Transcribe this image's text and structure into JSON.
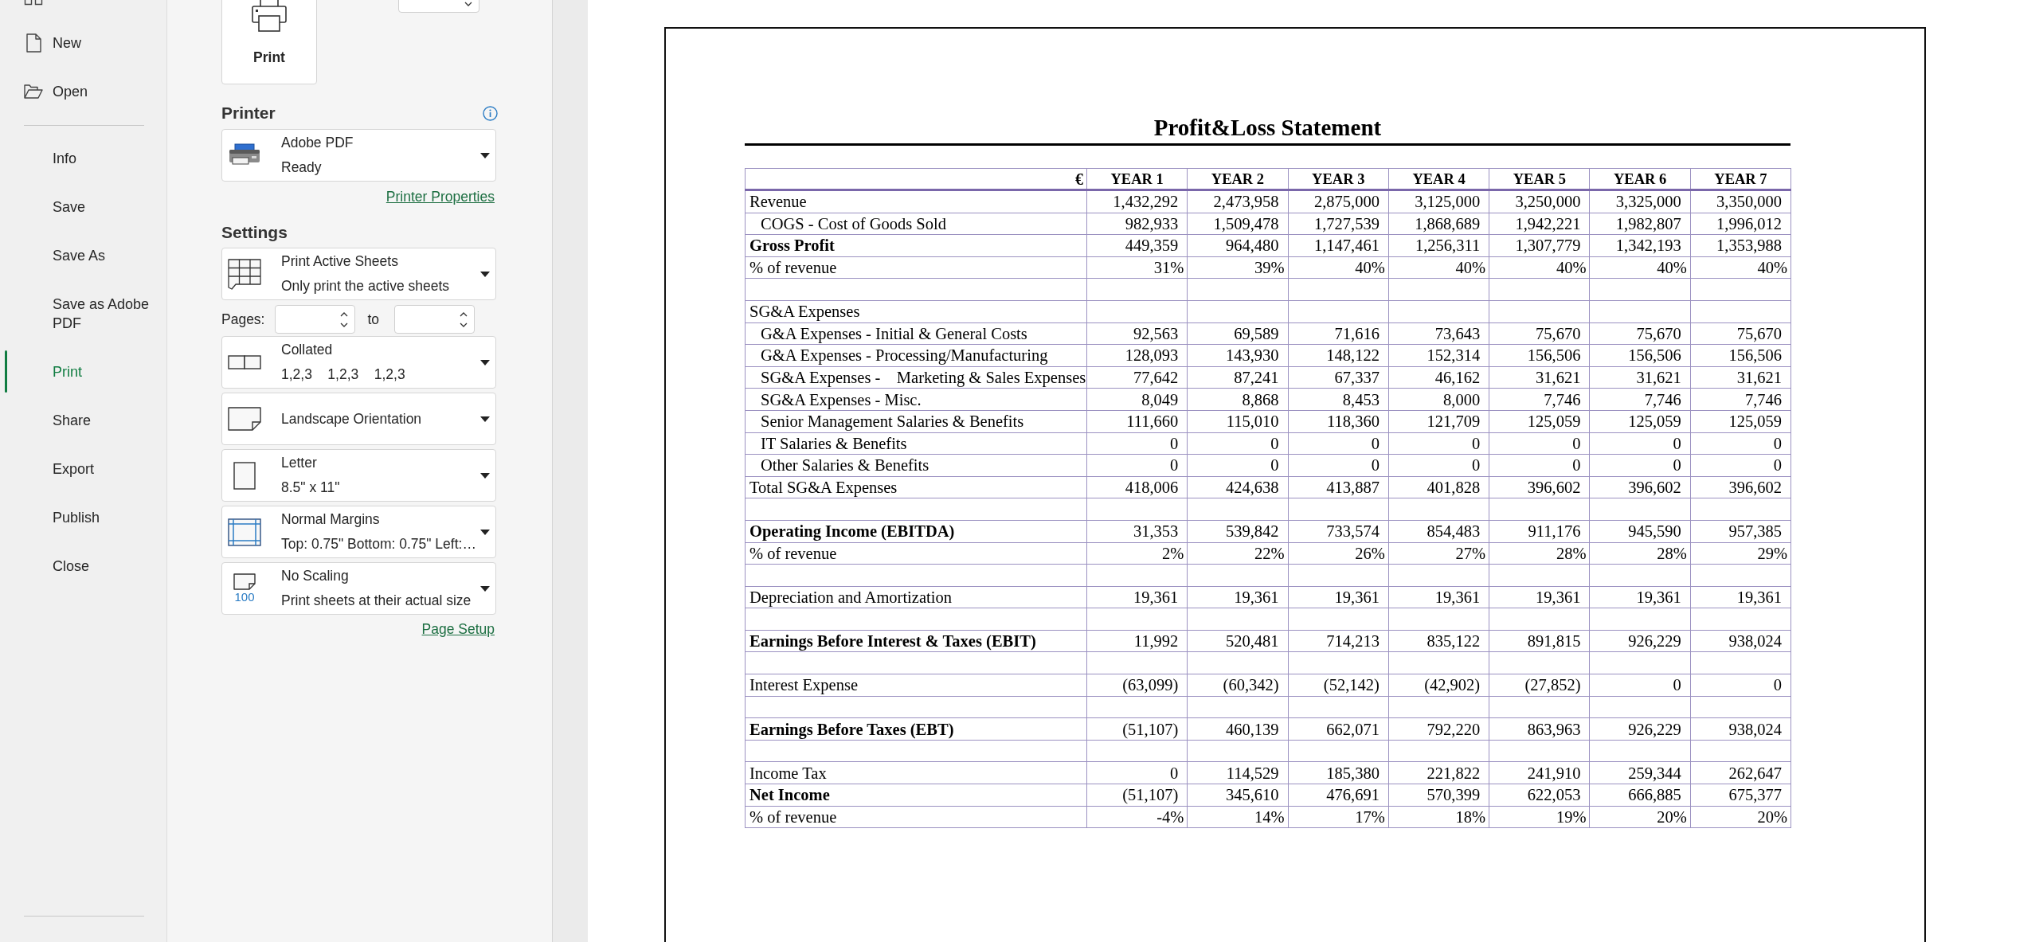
{
  "nav": {
    "top_items": [
      {
        "label": "New",
        "selected": false
      },
      {
        "label": "Open",
        "selected": false
      }
    ],
    "items": [
      {
        "label": "Info",
        "selected": false
      },
      {
        "label": "Save",
        "selected": false
      },
      {
        "label": "Save As",
        "selected": false
      },
      {
        "label": "Save as Adobe PDF",
        "selected": false
      },
      {
        "label": "Print",
        "selected": true
      },
      {
        "label": "Share",
        "selected": false
      },
      {
        "label": "Export",
        "selected": false
      },
      {
        "label": "Publish",
        "selected": false
      },
      {
        "label": "Close",
        "selected": false
      }
    ]
  },
  "print_panel": {
    "print_button": "Print"
  },
  "printer": {
    "heading": "Printer",
    "name": "Adobe PDF",
    "status": "Ready",
    "properties_link": "Printer Properties"
  },
  "settings": {
    "heading": "Settings",
    "items": [
      {
        "kind": "dropdown",
        "title": "Print Active Sheets",
        "subtitle": "Only print the active sheets"
      },
      {
        "kind": "pages",
        "label": "Pages:",
        "separator": "to"
      },
      {
        "kind": "dropdown",
        "title": "Collated",
        "subtitle": "1,2,3    1,2,3    1,2,3"
      },
      {
        "kind": "dropdown",
        "title": "Landscape Orientation"
      },
      {
        "kind": "dropdown",
        "title": "Letter",
        "subtitle": "8.5\" x 11\""
      },
      {
        "kind": "dropdown",
        "title": "Normal Margins",
        "subtitle": "Top: 0.75\" Bottom: 0.75\" Left:…"
      },
      {
        "kind": "dropdown",
        "title": "No Scaling",
        "subtitle": "Print sheets at their actual size",
        "icon_label": "100"
      }
    ],
    "page_setup_link": "Page Setup"
  },
  "sheet": {
    "title": "Profit&Loss Statement",
    "currency": "€",
    "columns": [
      "YEAR 1",
      "YEAR 2",
      "YEAR 3",
      "YEAR 4",
      "YEAR 5",
      "YEAR 6",
      "YEAR 7"
    ],
    "rows": [
      {
        "kind": "item",
        "label": "Revenue",
        "values": [
          "1,432,292",
          "2,473,958",
          "2,875,000",
          "3,125,000",
          "3,250,000",
          "3,325,000",
          "3,350,000"
        ]
      },
      {
        "kind": "sub",
        "label": "COGS - Cost of Goods Sold",
        "values": [
          "982,933",
          "1,509,478",
          "1,727,539",
          "1,868,689",
          "1,942,221",
          "1,982,807",
          "1,996,012"
        ]
      },
      {
        "kind": "total",
        "label": "Gross Profit",
        "values": [
          "449,359",
          "964,480",
          "1,147,461",
          "1,256,311",
          "1,307,779",
          "1,342,193",
          "1,353,988"
        ]
      },
      {
        "kind": "ratio",
        "label": "% of revenue",
        "values": [
          "31%",
          "39%",
          "40%",
          "40%",
          "40%",
          "40%",
          "40%"
        ]
      },
      {
        "kind": "blank"
      },
      {
        "kind": "item",
        "label": "SG&A Expenses"
      },
      {
        "kind": "sub",
        "label": "G&A Expenses - Initial & General Costs",
        "values": [
          "92,563",
          "69,589",
          "71,616",
          "73,643",
          "75,670",
          "75,670",
          "75,670"
        ]
      },
      {
        "kind": "sub",
        "label": "G&A Expenses - Processing/Manufacturing",
        "values": [
          "128,093",
          "143,930",
          "148,122",
          "152,314",
          "156,506",
          "156,506",
          "156,506"
        ]
      },
      {
        "kind": "sub",
        "label": "SG&A Expenses -    Marketing & Sales Expenses",
        "values": [
          "77,642",
          "87,241",
          "67,337",
          "46,162",
          "31,621",
          "31,621",
          "31,621"
        ]
      },
      {
        "kind": "sub",
        "label": "SG&A Expenses - Misc.",
        "values": [
          "8,049",
          "8,868",
          "8,453",
          "8,000",
          "7,746",
          "7,746",
          "7,746"
        ]
      },
      {
        "kind": "sub",
        "label": "Senior Management Salaries & Benefits",
        "values": [
          "111,660",
          "115,010",
          "118,360",
          "121,709",
          "125,059",
          "125,059",
          "125,059"
        ]
      },
      {
        "kind": "sub",
        "label": "IT Salaries & Benefits",
        "values": [
          "0",
          "0",
          "0",
          "0",
          "0",
          "0",
          "0"
        ]
      },
      {
        "kind": "sub",
        "label": "Other Salaries & Benefits",
        "values": [
          "0",
          "0",
          "0",
          "0",
          "0",
          "0",
          "0"
        ]
      },
      {
        "kind": "item",
        "label": "Total SG&A Expenses",
        "values": [
          "418,006",
          "424,638",
          "413,887",
          "401,828",
          "396,602",
          "396,602",
          "396,602"
        ]
      },
      {
        "kind": "blank"
      },
      {
        "kind": "total",
        "label": "Operating Income (EBITDA)",
        "values": [
          "31,353",
          "539,842",
          "733,574",
          "854,483",
          "911,176",
          "945,590",
          "957,385"
        ]
      },
      {
        "kind": "ratio",
        "label": "% of revenue",
        "values": [
          "2%",
          "22%",
          "26%",
          "27%",
          "28%",
          "28%",
          "29%"
        ]
      },
      {
        "kind": "blank"
      },
      {
        "kind": "item",
        "label": "Depreciation and Amortization",
        "values": [
          "19,361",
          "19,361",
          "19,361",
          "19,361",
          "19,361",
          "19,361",
          "19,361"
        ]
      },
      {
        "kind": "blank"
      },
      {
        "kind": "total",
        "label": "Earnings Before Interest & Taxes (EBIT)",
        "values": [
          "11,992",
          "520,481",
          "714,213",
          "835,122",
          "891,815",
          "926,229",
          "938,024"
        ]
      },
      {
        "kind": "blank"
      },
      {
        "kind": "item",
        "label": "Interest Expense",
        "values": [
          "(63,099)",
          "(60,342)",
          "(52,142)",
          "(42,902)",
          "(27,852)",
          "0",
          "0"
        ]
      },
      {
        "kind": "blank"
      },
      {
        "kind": "total",
        "label": "Earnings Before Taxes (EBT)",
        "values": [
          "(51,107)",
          "460,139",
          "662,071",
          "792,220",
          "863,963",
          "926,229",
          "938,024"
        ]
      },
      {
        "kind": "blank"
      },
      {
        "kind": "item",
        "label": "Income Tax",
        "values": [
          "0",
          "114,529",
          "185,380",
          "221,822",
          "241,910",
          "259,344",
          "262,647"
        ]
      },
      {
        "kind": "total",
        "label": "Net Income",
        "values": [
          "(51,107)",
          "345,610",
          "476,691",
          "570,399",
          "622,053",
          "666,885",
          "675,377"
        ]
      },
      {
        "kind": "ratio",
        "label": "% of revenue",
        "values": [
          "-4%",
          "14%",
          "17%",
          "18%",
          "19%",
          "20%",
          "20%"
        ]
      }
    ]
  }
}
